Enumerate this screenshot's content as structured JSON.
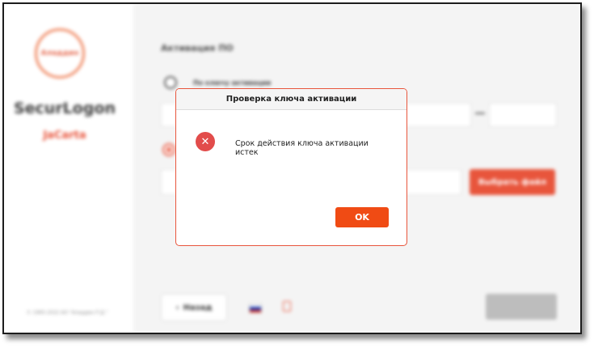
{
  "sidebar": {
    "logo_text": "Аладдин",
    "app_name": "SecurLogon",
    "app_subtitle": "JaCarta",
    "note": "",
    "copyright": "© 1995-2022 АО \"Аладдин Р.Д.\""
  },
  "content": {
    "page_title": "Активация ПО",
    "option_key_label": "По ключу активации",
    "choose_file_label": "Выбрать файл",
    "back_label": "Назад",
    "back_icon": "chevron-left-icon",
    "next_label": ""
  },
  "dialog": {
    "title": "Проверка ключа активации",
    "icon": "error-icon",
    "message": "Срок действия ключа активации истек",
    "ok_label": "OK"
  },
  "colors": {
    "accent": "#e8553c",
    "ok_button": "#f04b14",
    "error": "#e24c4b"
  }
}
